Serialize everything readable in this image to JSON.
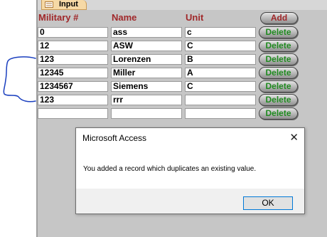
{
  "tab": {
    "label": "Input"
  },
  "headers": {
    "military": "Military #",
    "name": "Name",
    "unit": "Unit"
  },
  "buttons": {
    "add_label": "Add",
    "delete_label": "Delete"
  },
  "rows": [
    {
      "military": "0",
      "name": "ass",
      "unit": "c"
    },
    {
      "military": "12",
      "name": "ASW",
      "unit": "C"
    },
    {
      "military": "123",
      "name": "Lorenzen",
      "unit": "B"
    },
    {
      "military": "12345",
      "name": "Miller",
      "unit": "A"
    },
    {
      "military": "1234567",
      "name": "Siemens",
      "unit": "C"
    },
    {
      "military": "123",
      "name": "rrr",
      "unit": ""
    },
    {
      "military": "",
      "name": "",
      "unit": ""
    }
  ],
  "dialog": {
    "title": "Microsoft Access",
    "message": "You added a record which duplicates an existing value.",
    "ok_label": "OK",
    "close_symbol": "✕"
  },
  "colors": {
    "header_text": "#a0282a",
    "delete_text": "#1f8a1f",
    "form_background": "#c6c6c6",
    "annotation_stroke": "#1a3fbf"
  },
  "icons": {
    "tab": "form-icon",
    "annotation": "blue-bracket-scribble"
  }
}
